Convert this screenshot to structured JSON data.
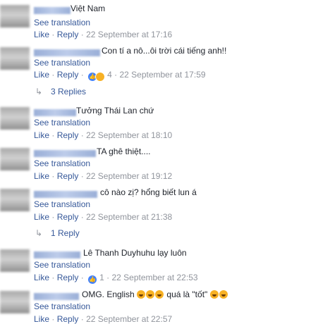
{
  "ui": {
    "see_translation": "See translation",
    "like": "Like",
    "reply": "Reply",
    "sep": "·"
  },
  "comments": [
    {
      "text": "Việt Nam",
      "time": "22 September at 17:16"
    },
    {
      "text": "Con tí a nô...ôi trời cái tiếng anh!!",
      "time": "22 September at 17:59",
      "reactions": "4",
      "replies": "3 Replies"
    },
    {
      "text": "Tưởng Thái Lan chứ",
      "time": "22 September at 18:10"
    },
    {
      "text": "TA ghê thiệt....",
      "time": "22 September at 19:12"
    },
    {
      "text": "cô nào zị? hổng biết lun á",
      "time": "22 September at 21:38",
      "replies": "1 Reply"
    },
    {
      "text": "Lê Thanh Duyhuhu lạy luôn",
      "time": "22 September at 22:53",
      "reactions": "1"
    },
    {
      "text_a": "OMG. English",
      "text_b": "quá là \"tốt\"",
      "time": "22 September at 22:57"
    }
  ]
}
